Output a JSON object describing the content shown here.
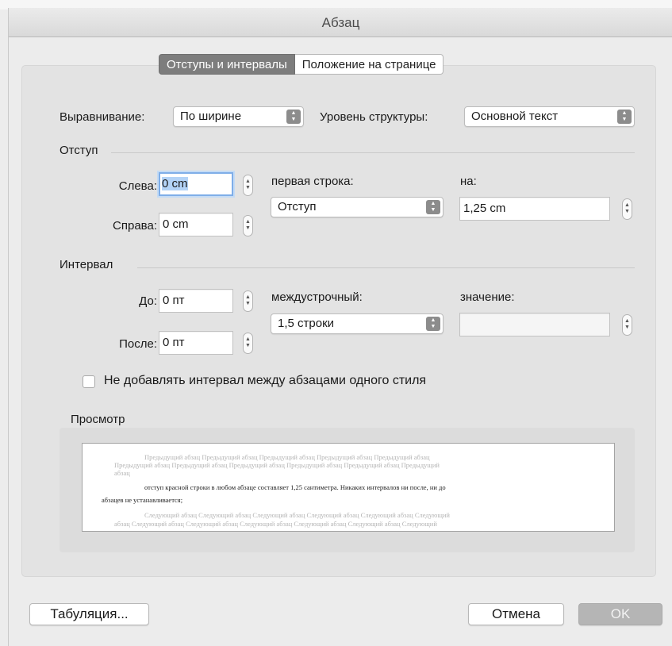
{
  "window": {
    "title": "Абзац"
  },
  "tabs": [
    {
      "label": "Отступы и интервалы",
      "active": true
    },
    {
      "label": "Положение на странице",
      "active": false
    }
  ],
  "alignment": {
    "label": "Выравнивание:",
    "value": "По ширине"
  },
  "outline_level": {
    "label": "Уровень структуры:",
    "value": "Основной текст"
  },
  "indent": {
    "section_label": "Отступ",
    "left": {
      "label": "Слева:",
      "value": "0 cm"
    },
    "right": {
      "label": "Справа:",
      "value": "0 cm"
    },
    "first_line": {
      "label": "первая строка:",
      "value": "Отступ"
    },
    "by": {
      "label": "на:",
      "value": "1,25 cm"
    }
  },
  "spacing": {
    "section_label": "Интервал",
    "before": {
      "label": "До:",
      "value": "0 пт"
    },
    "after": {
      "label": "После:",
      "value": "0 пт"
    },
    "line": {
      "label": "междустрочный:",
      "value": "1,5 строки"
    },
    "at": {
      "label": "значение:",
      "value": ""
    }
  },
  "dont_add_space": {
    "label": "Не добавлять интервал между абзацами одного стиля",
    "checked": false
  },
  "preview": {
    "label": "Просмотр",
    "prev_lines": [
      "Предыдущий абзац Предыдущий абзац Предыдущий абзац Предыдущий абзац Предыдущий абзац",
      "Предыдущий абзац Предыдущий абзац Предыдущий абзац Предыдущий абзац Предыдущий абзац Предыдущий",
      "абзац"
    ],
    "main_lines": [
      "отступ красной строки в любом абзаце составляет 1,25 сантиметра. Никаких интервалов ни после, ни до",
      "абзацев не устанавливается;"
    ],
    "next_lines": [
      "Следующий абзац Следующий абзац Следующий абзац Следующий абзац Следующий абзац Следующий",
      "абзац Следующий абзац Следующий абзац Следующий абзац Следующий абзац Следующий абзац Следующий"
    ]
  },
  "buttons": {
    "tabs": "Табуляция...",
    "cancel": "Отмена",
    "ok": "OK"
  },
  "icons": {
    "select_arrows": "updown-chevron-icon",
    "stepper": "stepper-arrows-icon"
  }
}
